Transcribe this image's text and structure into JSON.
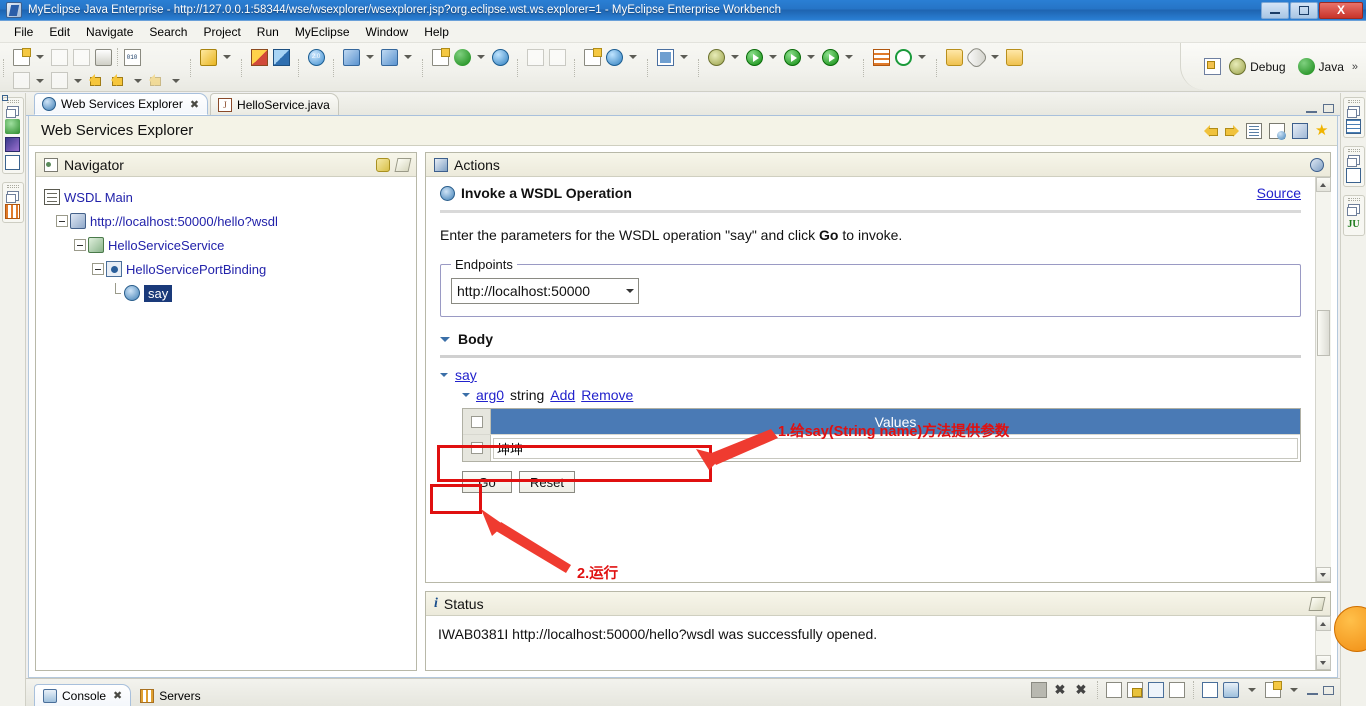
{
  "window": {
    "title": "MyEclipse Java Enterprise - http://127.0.0.1:58344/wse/wsexplorer/wsexplorer.jsp?org.eclipse.wst.ws.explorer=1 - MyEclipse Enterprise Workbench",
    "app_icon": "myeclipse-icon",
    "minimize_label": "–",
    "maximize_label": "❐",
    "close_label": "X"
  },
  "menubar": {
    "items": [
      {
        "label": "File"
      },
      {
        "label": "Edit"
      },
      {
        "label": "Navigate"
      },
      {
        "label": "Search"
      },
      {
        "label": "Project"
      },
      {
        "label": "Run"
      },
      {
        "label": "MyEclipse"
      },
      {
        "label": "Window"
      },
      {
        "label": "Help"
      }
    ]
  },
  "perspective_bar": {
    "open_perspective_icon": "open-perspective-icon",
    "items": [
      {
        "label": "Debug",
        "icon": "debug-perspective-icon"
      },
      {
        "label": "Java",
        "icon": "java-perspective-icon"
      }
    ],
    "chevron": "»"
  },
  "editor_tabs": [
    {
      "label": "Web Services Explorer",
      "icon": "web-services-explorer-icon",
      "active": true,
      "close": "✖"
    },
    {
      "label": "HelloService.java",
      "icon": "java-file-icon",
      "active": false
    }
  ],
  "view": {
    "title": "Web Services Explorer",
    "toolbar_icons": [
      "back-icon",
      "forward-icon",
      "navigator-list-icon",
      "source-page-icon",
      "properties-icon",
      "favorites-star-icon"
    ]
  },
  "navigator": {
    "title": "Navigator",
    "header_icons": [
      "link-chain-icon",
      "pencil-edit-icon"
    ],
    "tree": [
      {
        "label": "WSDL Main",
        "icon": "wsdl-main-icon",
        "indent": 0,
        "twisty": "none",
        "selected": false
      },
      {
        "label": "http://localhost:50000/hello?wsdl",
        "icon": "wsdl-url-icon",
        "indent": 1,
        "twisty": "expanded",
        "selected": false
      },
      {
        "label": "HelloServiceService",
        "icon": "service-icon",
        "indent": 2,
        "twisty": "expanded",
        "selected": false
      },
      {
        "label": "HelloServicePortBinding",
        "icon": "port-binding-icon",
        "indent": 3,
        "twisty": "expanded",
        "selected": false
      },
      {
        "label": "say",
        "icon": "operation-icon",
        "indent": 4,
        "twisty": "leaf",
        "selected": true
      }
    ]
  },
  "actions": {
    "panel_title": "Actions",
    "panel_icon": "actions-icon",
    "panel_header_right_icon": "actions-preferences-icon",
    "heading": "Invoke a WSDL Operation",
    "heading_icon": "invoke-operation-icon",
    "source_link": "Source",
    "instruction_prefix": "Enter the parameters for the WSDL operation \"say\" and click ",
    "instruction_bold": "Go",
    "instruction_suffix": " to invoke.",
    "endpoints": {
      "legend": "Endpoints",
      "selected_value": "http://localhost:50000",
      "dropdown_icon": "chevron-down-icon"
    },
    "body": {
      "label": "Body",
      "operation_link": "say",
      "arg": {
        "name": "arg0",
        "type": "string",
        "add_label": "Add",
        "remove_label": "Remove"
      },
      "table": {
        "header": "Values",
        "rows": [
          {
            "value": "坤坤"
          }
        ]
      }
    },
    "buttons": {
      "go": "Go",
      "reset": "Reset"
    }
  },
  "annotations": [
    {
      "id": "anno-1",
      "text": "1.给say(String name)方法提供参数",
      "color": "#e01010"
    },
    {
      "id": "anno-2",
      "text": "2.运行",
      "color": "#e01010"
    }
  ],
  "status": {
    "panel_title": "Status",
    "panel_icon": "info-icon",
    "panel_header_right_icon": "pencil-edit-icon",
    "message": "IWAB0381I http://localhost:50000/hello?wsdl was successfully opened."
  },
  "bottom_tabs": [
    {
      "label": "Console",
      "icon": "console-icon",
      "active": true,
      "close": "✖"
    },
    {
      "label": "Servers",
      "icon": "servers-icon",
      "active": false
    }
  ],
  "bottom_toolbar_icons": [
    "terminate-icon",
    "remove-launch-icon",
    "remove-all-launches-icon",
    "clear-console-icon",
    "scroll-lock-icon",
    "pin-console-icon",
    "display-selected-console-icon",
    "open-console-icon",
    "console-view-menu-icon",
    "new-console-view-icon",
    "minimize-icon",
    "maximize-icon"
  ],
  "left_fastview_icons": [
    "restore-icon",
    "package-explorer-icon",
    "navigator-icon",
    "outline-icon",
    "restore-icon-2",
    "servers-view-icon"
  ],
  "right_fastview_icons": [
    "restore-icon",
    "table-view-icon",
    "restore-icon-2",
    "outline-view-icon",
    "restore-icon-3",
    "junit-view-icon"
  ],
  "colors": {
    "titlebar": "#2a7fd4",
    "table_header": "#4a7ab5",
    "link": "#2222cc",
    "selection": "#1a3a7a",
    "annotation": "#e01010",
    "panel_header": "#f4f3e7"
  }
}
